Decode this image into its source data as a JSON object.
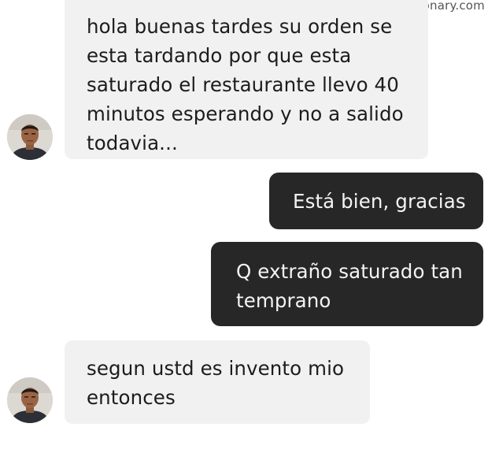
{
  "watermark": "notadictionary.com",
  "messages": [
    {
      "sender": "other",
      "lines": [
        "hola buenas tardes su orden se",
        "esta tardando por que esta",
        "saturado el restaurante llevo 40",
        "minutos esperando y no a salido",
        "todavia..."
      ]
    },
    {
      "sender": "me",
      "lines": [
        "Está bien, gracias"
      ]
    },
    {
      "sender": "me",
      "lines": [
        "Q extraño saturado tan",
        "temprano"
      ]
    },
    {
      "sender": "other",
      "lines": [
        "segun ustd es invento mio",
        "entonces"
      ]
    }
  ],
  "colors": {
    "incoming_bubble": "#f1f1f1",
    "outgoing_bubble": "#272727",
    "incoming_text": "#1c1c1c",
    "outgoing_text": "#f4f4f4"
  }
}
